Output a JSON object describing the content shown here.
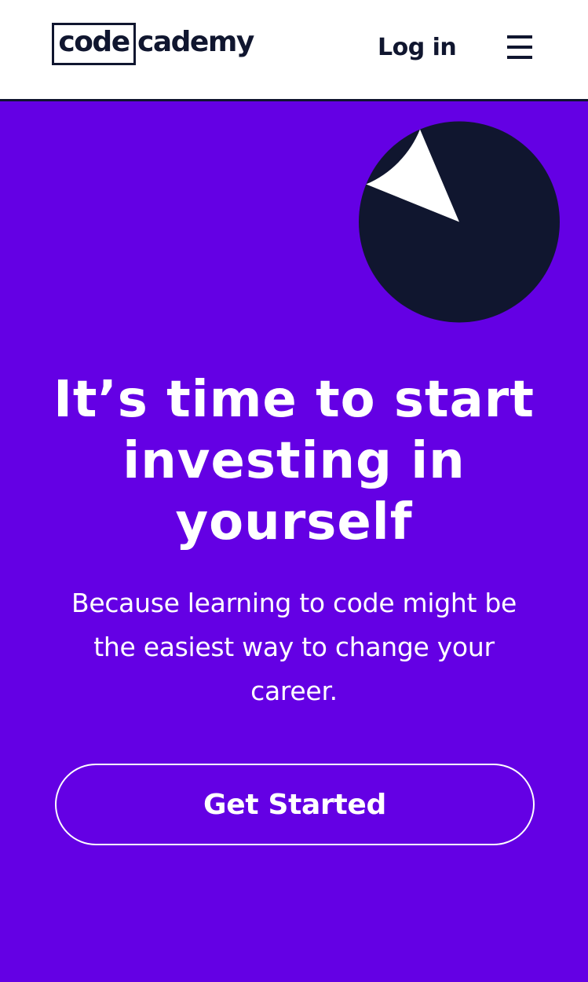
{
  "header": {
    "logo": {
      "boxed_text": "code",
      "rest_text": "cademy"
    },
    "login_label": "Log in",
    "menu_icon": "hamburger-menu-icon"
  },
  "hero": {
    "illustration": "pie-illustration",
    "slice_fraction": 0.125,
    "title_lines": [
      "It’s time to start",
      "investing in",
      "yourself"
    ],
    "subtitle_lines": [
      "Because learning to code might be",
      "the easiest way to change your",
      "career."
    ],
    "cta_label": "Get Started"
  },
  "colors": {
    "background": "#6400e4",
    "navy": "#10162f",
    "header": "#ffffff",
    "text": "#ffffff"
  }
}
